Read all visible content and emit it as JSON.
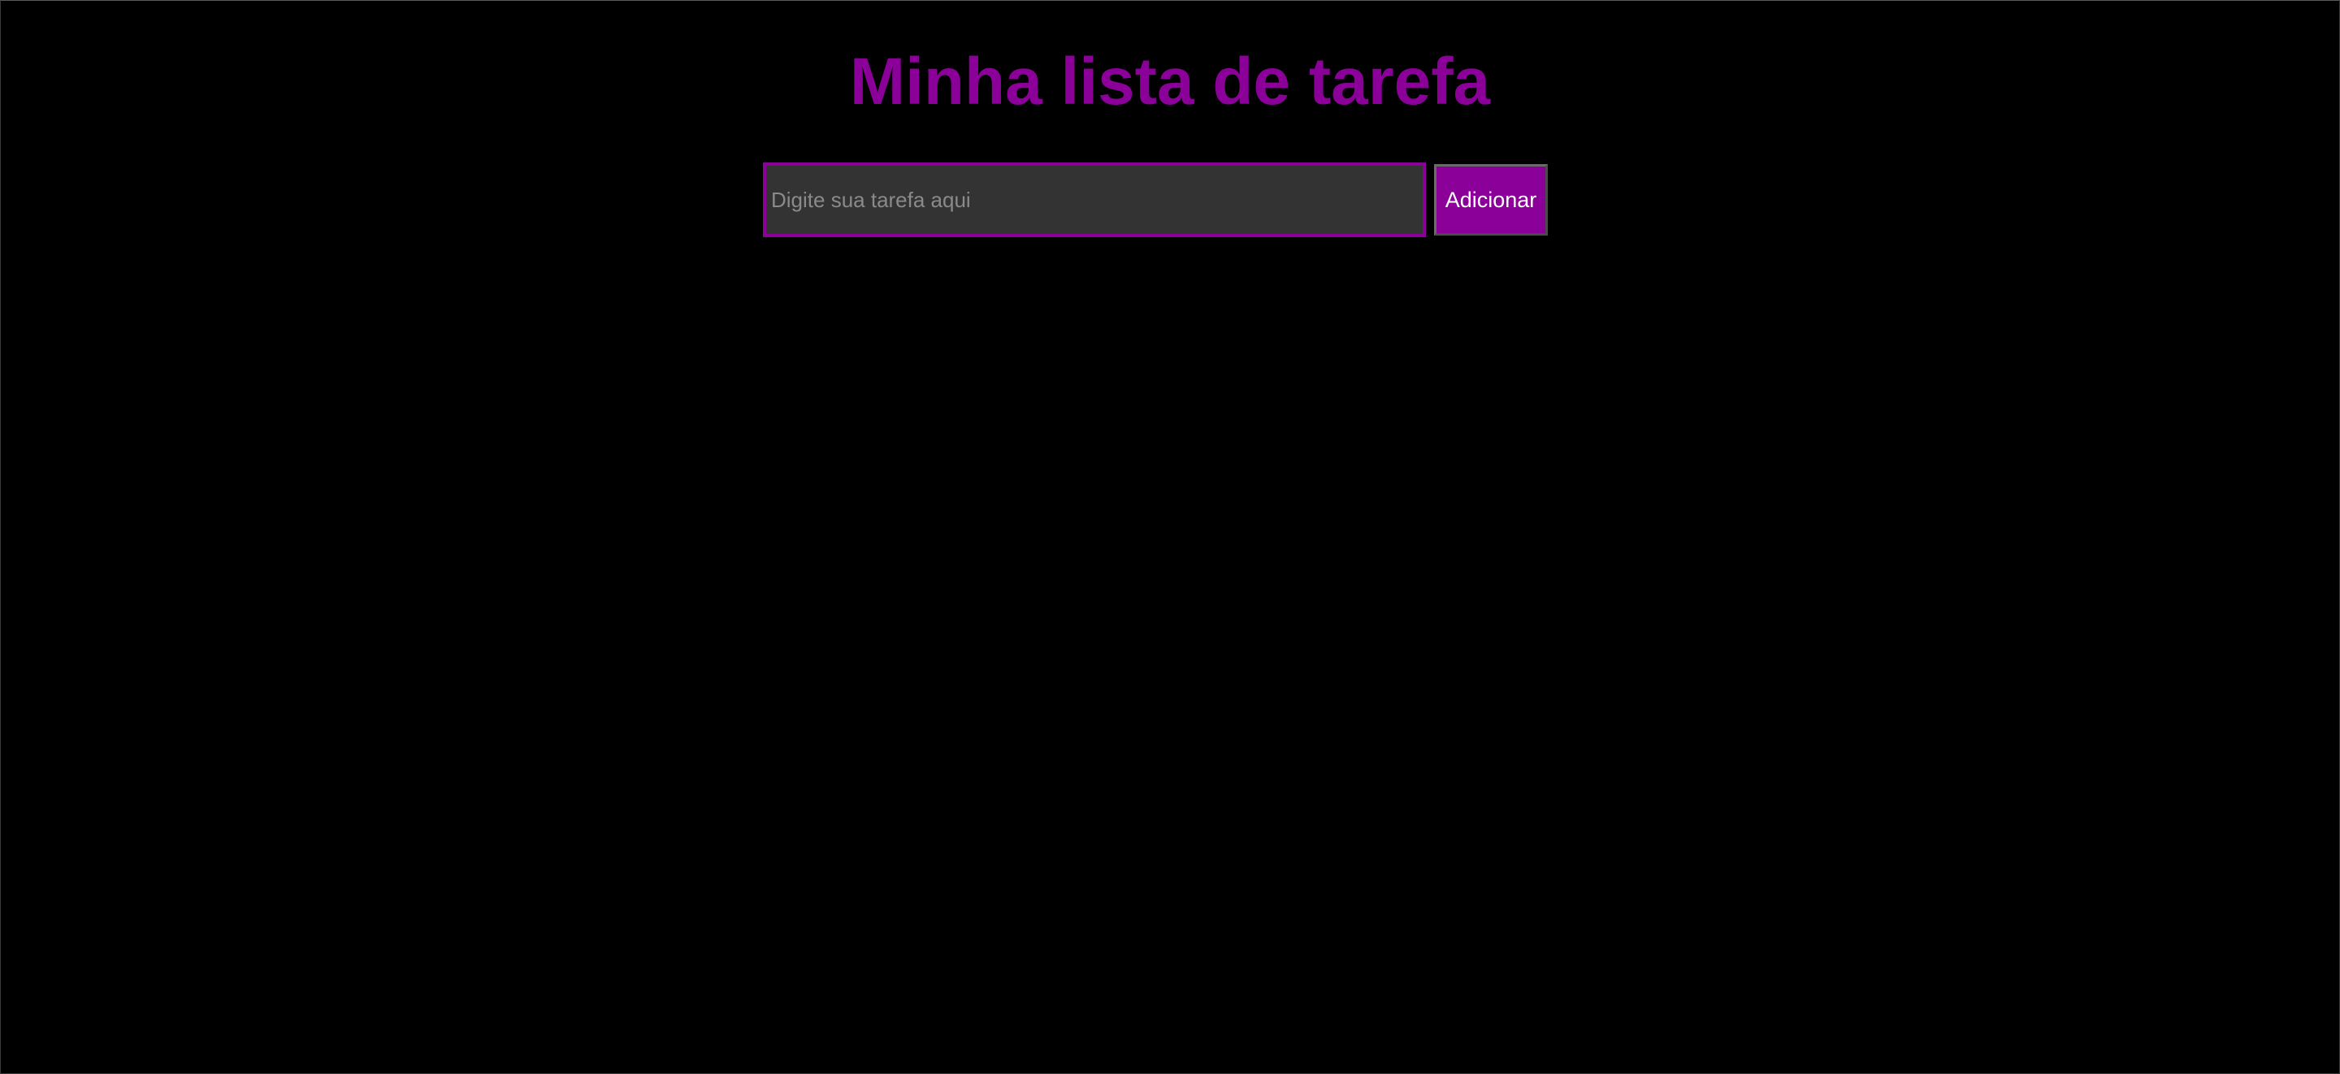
{
  "app": {
    "title": "Minha lista de tarefa"
  },
  "form": {
    "input": {
      "placeholder": "Digite sua tarefa aqui",
      "value": ""
    },
    "add_button_label": "Adicionar"
  },
  "colors": {
    "background": "#000000",
    "accent": "#8a0099",
    "input_background": "#333333",
    "button_text": "#ffffff",
    "placeholder_text": "#8a8a8a"
  },
  "tasks": []
}
